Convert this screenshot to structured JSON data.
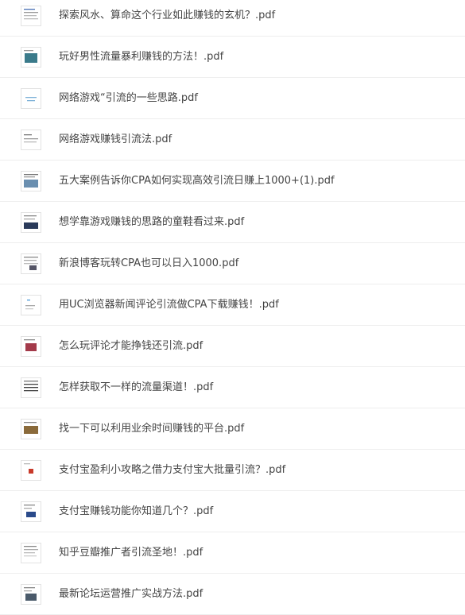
{
  "files": [
    {
      "name": "探索风水、算命这个行业如此赚钱的玄机？.pdf",
      "icon": "document-thumbnail-icon"
    },
    {
      "name": "玩好男性流量暴利赚钱的方法！.pdf",
      "icon": "document-thumbnail-icon"
    },
    {
      "name": "网络游戏“引流的一些思路.pdf",
      "icon": "document-thumbnail-icon"
    },
    {
      "name": "网络游戏赚钱引流法.pdf",
      "icon": "document-thumbnail-icon"
    },
    {
      "name": "五大案例告诉你CPA如何实现高效引流日赚上1000+(1).pdf",
      "icon": "document-thumbnail-icon"
    },
    {
      "name": "想学靠游戏赚钱的思路的童鞋看过来.pdf",
      "icon": "document-thumbnail-icon"
    },
    {
      "name": "新浪博客玩转CPA也可以日入1000.pdf",
      "icon": "document-thumbnail-icon"
    },
    {
      "name": "用UC浏览器新闻评论引流做CPA下载赚钱！.pdf",
      "icon": "document-thumbnail-icon"
    },
    {
      "name": "怎么玩评论才能挣钱还引流.pdf",
      "icon": "document-thumbnail-icon"
    },
    {
      "name": "怎样获取不一样的流量渠道！.pdf",
      "icon": "document-thumbnail-icon"
    },
    {
      "name": "找一下可以利用业余时间赚钱的平台.pdf",
      "icon": "document-thumbnail-icon"
    },
    {
      "name": "支付宝盈利小攻略之借力支付宝大批量引流？.pdf",
      "icon": "document-thumbnail-icon"
    },
    {
      "name": "支付宝赚钱功能你知道几个？.pdf",
      "icon": "document-thumbnail-icon"
    },
    {
      "name": "知乎豆瓣推广者引流圣地！.pdf",
      "icon": "document-thumbnail-icon"
    },
    {
      "name": "最新论坛运营推广实战方法.pdf",
      "icon": "document-thumbnail-icon"
    }
  ]
}
